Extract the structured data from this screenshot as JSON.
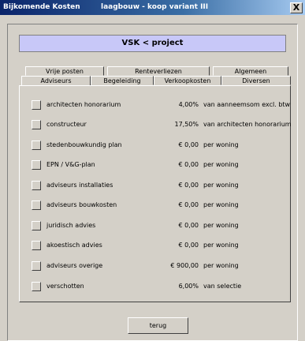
{
  "window": {
    "title": "Bijkomende Kosten",
    "subtitle": "laagbouw - koop variant III",
    "close_label": "X"
  },
  "header": {
    "project_label": "VSK < project"
  },
  "tabs": {
    "back_row": [
      "Vrije posten",
      "Renteverliezen",
      "Algemeen"
    ],
    "front_row": [
      "Adviseurs",
      "Begeleiding",
      "Verkoopkosten",
      "Diversen"
    ],
    "active": "Adviseurs"
  },
  "items": [
    {
      "label": "architecten honorarium",
      "value": "4,00%",
      "unit": "van aanneemsom excl. btw"
    },
    {
      "label": "constructeur",
      "value": "17,50%",
      "unit": "van architecten honorarium"
    },
    {
      "label": "stedenbouwkundig plan",
      "value": "€ 0,00",
      "unit": "per woning"
    },
    {
      "label": "EPN / V&G-plan",
      "value": "€ 0,00",
      "unit": "per woning"
    },
    {
      "label": "adviseurs installaties",
      "value": "€ 0,00",
      "unit": "per woning"
    },
    {
      "label": "adviseurs bouwkosten",
      "value": "€ 0,00",
      "unit": "per woning"
    },
    {
      "label": "juridisch advies",
      "value": "€ 0,00",
      "unit": "per woning"
    },
    {
      "label": "akoestisch advies",
      "value": "€ 0,00",
      "unit": "per woning"
    },
    {
      "label": "adviseurs overige",
      "value": "€ 900,00",
      "unit": "per woning"
    },
    {
      "label": "verschotten",
      "value": "6,00%",
      "unit": "van selectie"
    }
  ],
  "footer": {
    "back_button": "terug"
  }
}
